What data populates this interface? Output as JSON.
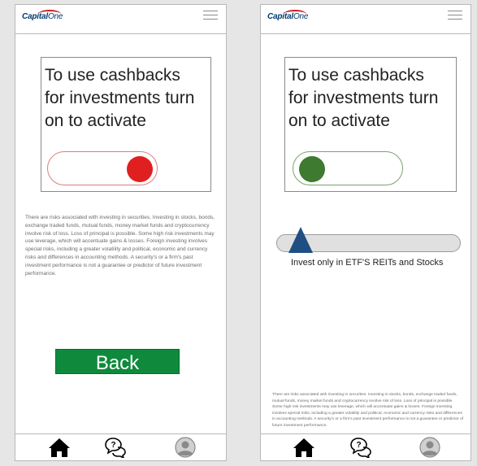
{
  "brand": {
    "logo_text": "Capital",
    "logo_text_2": "One"
  },
  "left_screen": {
    "activate_text": [
      "To use cashbacks",
      "for investments turn",
      "on to activate"
    ],
    "toggle_state": "off",
    "disclaimer": "There are risks associated with investing in securities. Investing in stocks, bonds, exchange traded funds, mutual funds, money market funds and cryptocurrency involve risk of loss.  Loss of principal is possible. Some high risk investments may use leverage, which will accentuate gains & losses. Foreign investing involves special risks, including a greater volatility and political, economic and currency risks and differences in accounting methods.  A security's or a firm's past investment performance is not a guarantee or predictor of future investment performance.",
    "back_label": "Back"
  },
  "right_screen": {
    "activate_text": [
      "To use cashbacks",
      "for investments turn",
      "on to activate"
    ],
    "toggle_state": "on",
    "slider_label": "Invest only in ETF'S REITs and Stocks",
    "slider_value": 0.08,
    "disclaimer": "There are risks associated with investing in securities. Investing in stocks, bonds, exchange traded funds, mutual funds, money market funds and cryptocurrency involve risk of loss.  Loss of principal is possible. Some high risk investments may use leverage, which will accentuate gains & losses. Foreign investing involves special risks, including a greater volatility and political, economic and currency risks and differences in accounting methods.  A security's or a firm's past investment performance is not a guarantee or predictor of future investment performance."
  },
  "colors": {
    "toggle_off_knob": "#e02020",
    "toggle_on_knob": "#3e7a30",
    "back_button": "#0f8a3c",
    "slider_thumb": "#1f4f82"
  },
  "nav_icons": [
    "home-icon",
    "chat-help-icon",
    "profile-icon"
  ]
}
